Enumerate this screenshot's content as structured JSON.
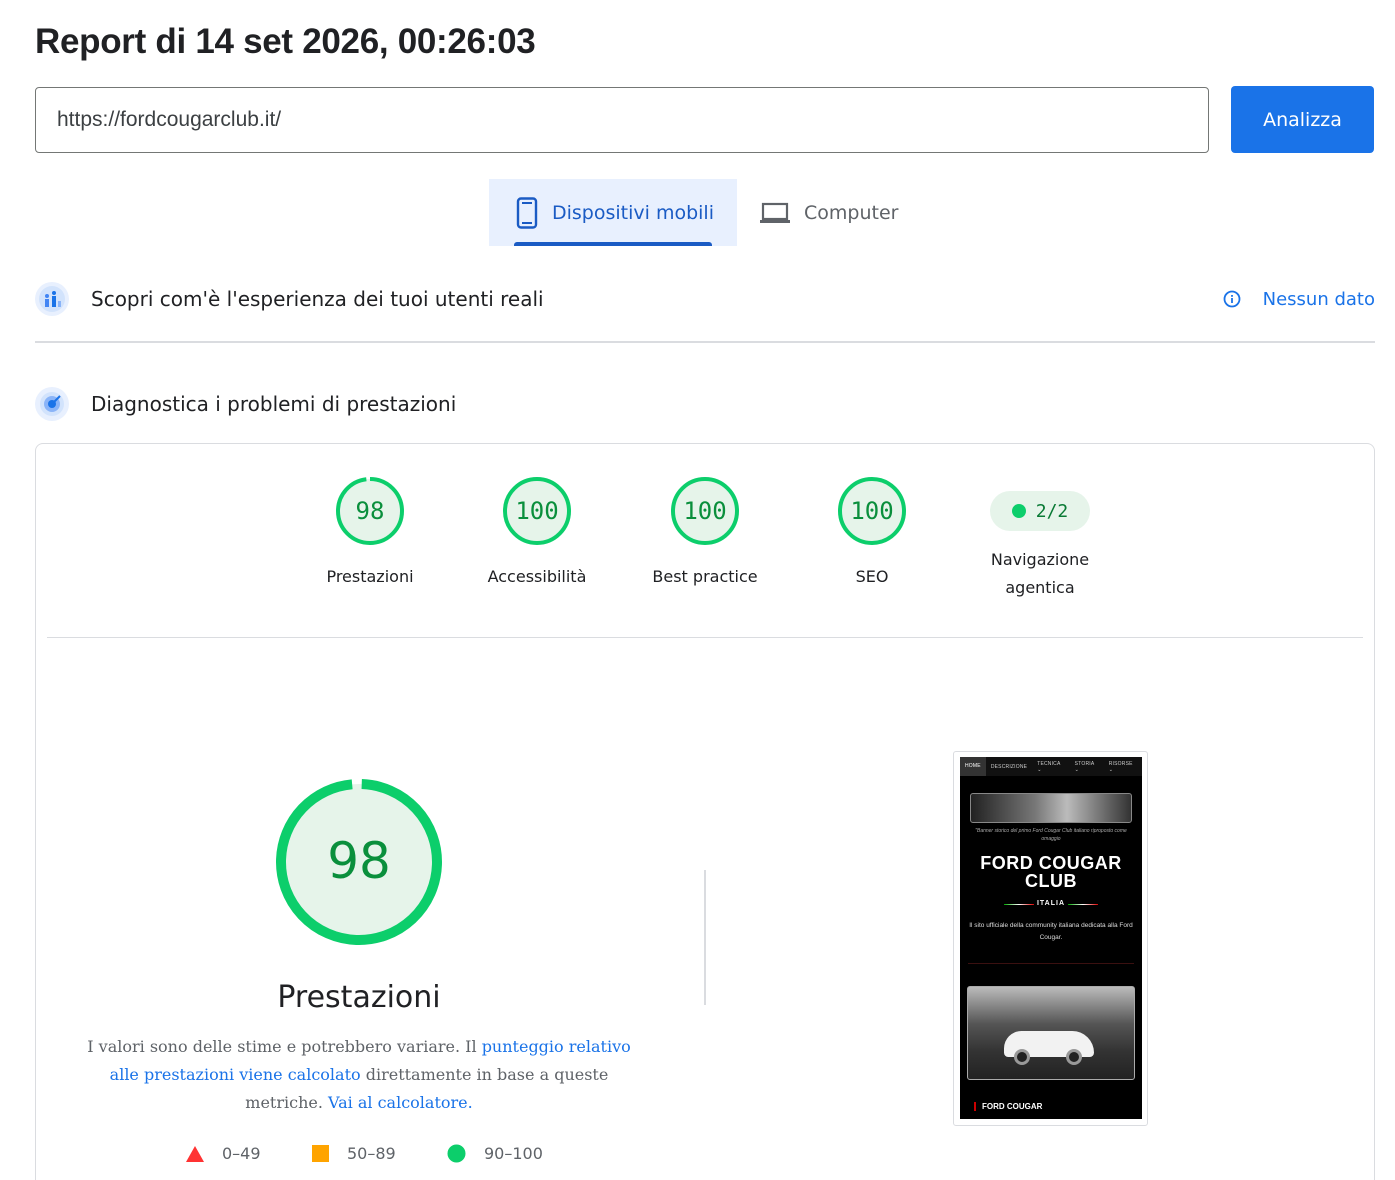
{
  "report": {
    "title": "Report di 14 set 2026, 00:26:03"
  },
  "search": {
    "url": "https://fordcougarclub.it/",
    "analyze_label": "Analizza"
  },
  "device_tabs": {
    "mobile": "Dispositivi mobili",
    "desktop": "Computer"
  },
  "field_data": {
    "title": "Scopri com'è l'esperienza dei tuoi utenti reali",
    "status": "Nessun dato"
  },
  "lab_data": {
    "title": "Diagnostica i problemi di prestazioni"
  },
  "scores": [
    {
      "value": "98",
      "label": "Prestazioni"
    },
    {
      "value": "100",
      "label": "Accessibilità"
    },
    {
      "value": "100",
      "label": "Best practice"
    },
    {
      "value": "100",
      "label": "SEO"
    }
  ],
  "agentic": {
    "value": "2/2",
    "label_line1": "Navigazione",
    "label_line2": "agentica"
  },
  "performance": {
    "score": "98",
    "score_fraction": 0.98,
    "label": "Prestazioni",
    "desc_part1": "I valori sono delle stime e potrebbero variare. Il ",
    "desc_link1": "punteggio relativo alle prestazioni viene calcolato",
    "desc_part2": " direttamente in base a queste metriche. ",
    "desc_link2": "Vai al calcolatore."
  },
  "legend": {
    "fail": "0–49",
    "average": "50–89",
    "pass": "90–100"
  },
  "screenshot": {
    "nav": [
      "HOME",
      "DESCRIZIONE",
      "TECNICA ⌄",
      "STORIA ⌄",
      "RISORSE ⌄"
    ],
    "caption": "\"Banner storico del primo Ford Cougar Club italiano riproposto come omaggio",
    "title_line1": "FORD COUGAR",
    "title_line2": "CLUB",
    "country": "ITALIA",
    "subtitle": "Il sito ufficiale della community italiana dedicata alla Ford Cougar.",
    "footer": "FORD COUGAR"
  },
  "colors": {
    "pass": "#0cce6b",
    "average": "#ffa400",
    "fail": "#ff4e42",
    "accent": "#1a73e8"
  }
}
